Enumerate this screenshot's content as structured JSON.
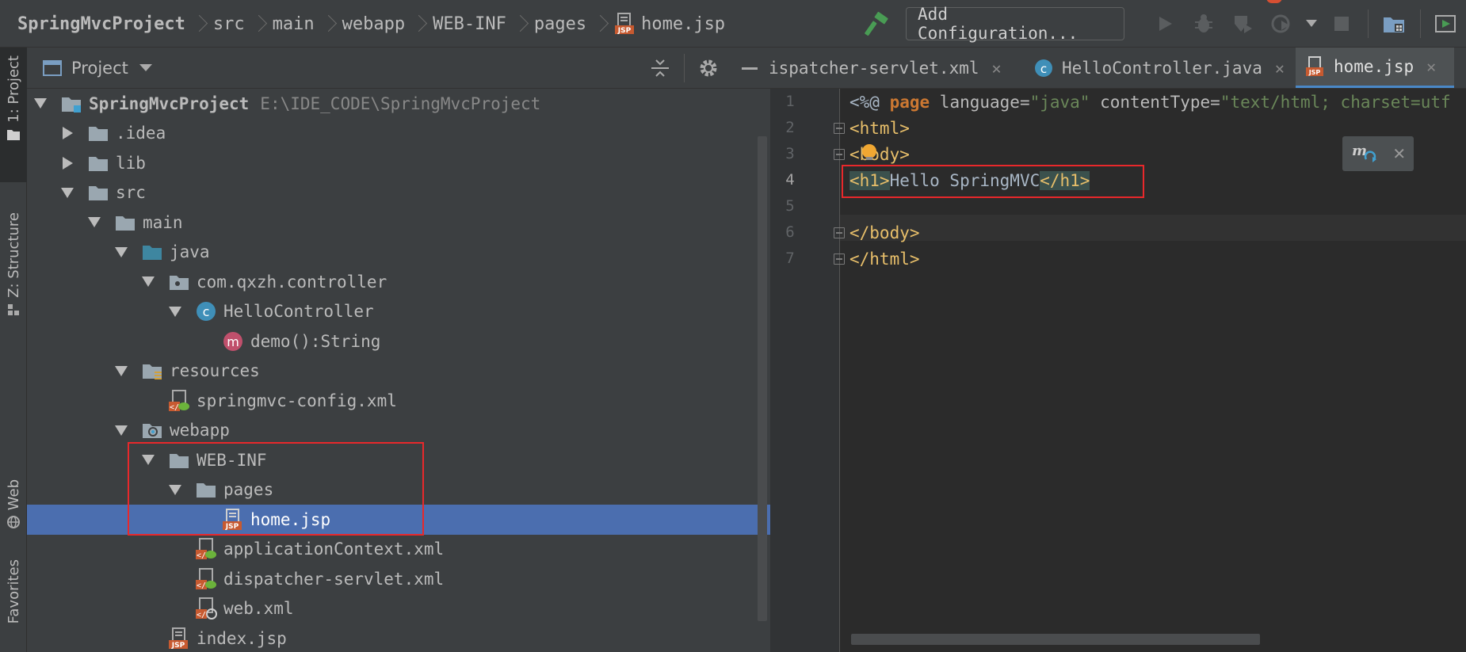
{
  "breadcrumbs": [
    "SpringMvcProject",
    "src",
    "main",
    "webapp",
    "WEB-INF",
    "pages",
    "home.jsp"
  ],
  "toolbar": {
    "add_config_label": "Add Configuration..."
  },
  "left_strip": {
    "tabs": [
      "1: Project",
      "Z: Structure",
      "Web",
      "Favorites"
    ]
  },
  "project_panel": {
    "title": "Project",
    "tree": [
      {
        "label": "SpringMvcProject",
        "path": "E:\\IDE_CODE\\SpringMvcProject",
        "icon": "module-folder-icon",
        "expanded": true
      },
      {
        "label": ".idea",
        "icon": "folder-icon",
        "expanded": false
      },
      {
        "label": "lib",
        "icon": "folder-icon",
        "expanded": false
      },
      {
        "label": "src",
        "icon": "folder-icon",
        "expanded": true
      },
      {
        "label": "main",
        "icon": "folder-icon",
        "expanded": true
      },
      {
        "label": "java",
        "icon": "source-folder-icon",
        "expanded": true
      },
      {
        "label": "com.qxzh.controller",
        "icon": "package-icon",
        "expanded": true
      },
      {
        "label": "HelloController",
        "icon": "class-icon",
        "expanded": true
      },
      {
        "label": "demo():String",
        "icon": "method-icon"
      },
      {
        "label": "resources",
        "icon": "resources-folder-icon",
        "expanded": true
      },
      {
        "label": "springmvc-config.xml",
        "icon": "spring-xml-icon"
      },
      {
        "label": "webapp",
        "icon": "web-folder-icon",
        "expanded": true
      },
      {
        "label": "WEB-INF",
        "icon": "folder-icon",
        "expanded": true
      },
      {
        "label": "pages",
        "icon": "folder-icon",
        "expanded": true
      },
      {
        "label": "home.jsp",
        "icon": "jsp-file-icon",
        "selected": true
      },
      {
        "label": "applicationContext.xml",
        "icon": "spring-xml-icon"
      },
      {
        "label": "dispatcher-servlet.xml",
        "icon": "spring-xml-icon"
      },
      {
        "label": "web.xml",
        "icon": "web-xml-icon"
      },
      {
        "label": "index.jsp",
        "icon": "jsp-file-icon"
      }
    ]
  },
  "editor": {
    "tabs": [
      {
        "label": "ispatcher-servlet.xml",
        "icon": "spring-xml-icon"
      },
      {
        "label": "HelloController.java",
        "icon": "class-icon"
      },
      {
        "label": "home.jsp",
        "icon": "jsp-file-icon",
        "active": true
      }
    ],
    "lines": [
      "1",
      "2",
      "3",
      "4",
      "5",
      "6",
      "7"
    ],
    "code": {
      "l1": {
        "open": "<%@ ",
        "dir": "page",
        "a1": " language=",
        "v1": "\"java\"",
        "a2": " contentType=",
        "v2": "\"text/html; charset=utf"
      },
      "l2": "<html>",
      "l3": "<body>",
      "l4": {
        "open": "<h1>",
        "text": "Hello SpringMVC",
        "close": "</h1>"
      },
      "l6": "</body>",
      "l7": "</html>"
    }
  },
  "colors": {
    "accent_blue": "#4b6eaf",
    "highlight_red": "#e8282b",
    "tag_yellow": "#e8bf6a",
    "string_green": "#6a8759",
    "keyword_orange": "#cc7832"
  }
}
